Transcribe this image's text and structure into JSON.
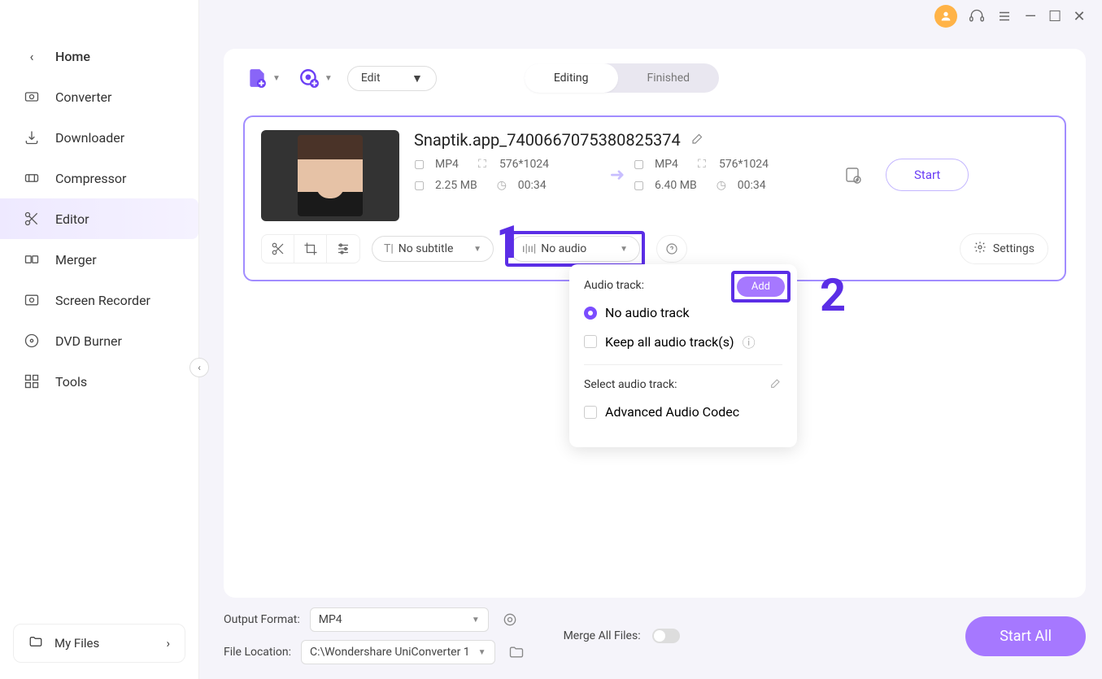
{
  "titlebar": {
    "avatar_icon": "user",
    "support_icon": "headset",
    "menu_icon": "menu",
    "min_icon": "minimize",
    "max_icon": "maximize",
    "close_icon": "close"
  },
  "sidebar": {
    "items": [
      {
        "label": "Home",
        "icon": "chevron-left"
      },
      {
        "label": "Converter",
        "icon": "converter"
      },
      {
        "label": "Downloader",
        "icon": "download"
      },
      {
        "label": "Compressor",
        "icon": "compress"
      },
      {
        "label": "Editor",
        "icon": "scissors",
        "active": true
      },
      {
        "label": "Merger",
        "icon": "merge"
      },
      {
        "label": "Screen Recorder",
        "icon": "record"
      },
      {
        "label": "DVD Burner",
        "icon": "disc"
      },
      {
        "label": "Tools",
        "icon": "grid"
      }
    ],
    "my_files": "My Files"
  },
  "toolbar": {
    "edit_label": "Edit",
    "tabs": {
      "editing": "Editing",
      "finished": "Finished"
    }
  },
  "file": {
    "name": "Snaptik.app_7400667075380825374",
    "input": {
      "format": "MP4",
      "resolution": "576*1024",
      "size": "2.25 MB",
      "duration": "00:34"
    },
    "output": {
      "format": "MP4",
      "resolution": "576*1024",
      "size": "6.40 MB",
      "duration": "00:34"
    },
    "start_label": "Start",
    "subtitle_label": "No subtitle",
    "audio_label": "No audio",
    "settings_label": "Settings"
  },
  "audio_panel": {
    "title": "Audio track:",
    "add_label": "Add",
    "no_audio": "No audio track",
    "keep_all": "Keep all audio track(s)",
    "select_label": "Select audio track:",
    "advanced": "Advanced Audio Codec"
  },
  "annotations": {
    "one": "1",
    "two": "2"
  },
  "bottom": {
    "output_format_label": "Output Format:",
    "output_format_value": "MP4",
    "file_location_label": "File Location:",
    "file_location_value": "C:\\Wondershare UniConverter 1",
    "merge_label": "Merge All Files:",
    "start_all": "Start All"
  }
}
